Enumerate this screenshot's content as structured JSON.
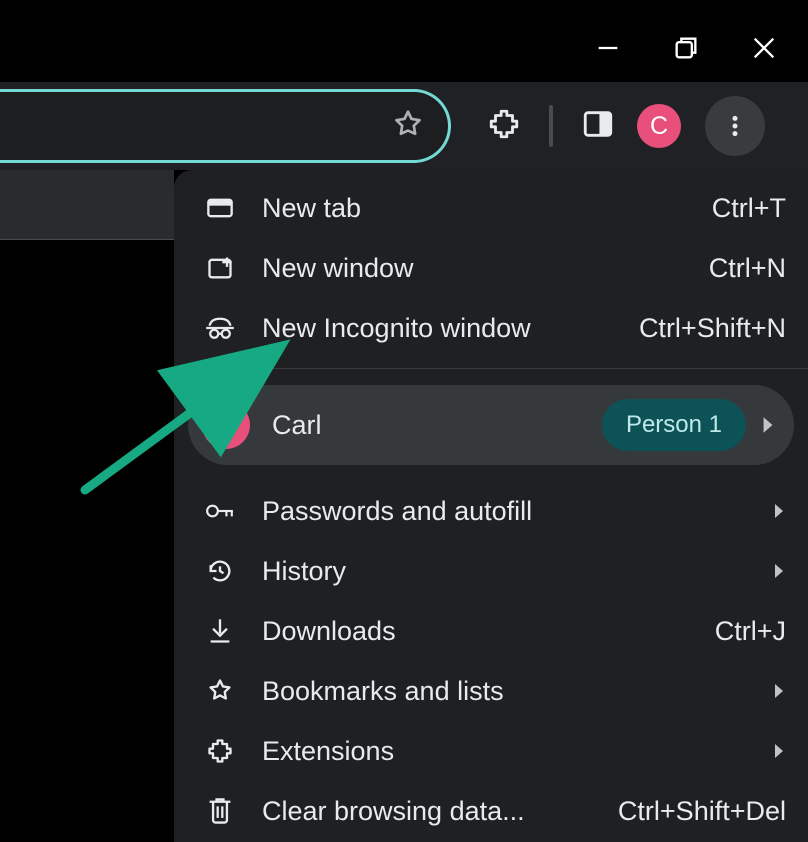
{
  "window_controls": {
    "minimize": "minimize",
    "maximize": "maximize",
    "close": "close"
  },
  "toolbar": {
    "omnibox_value": "",
    "star_icon": "bookmark-star",
    "extensions_icon": "extensions",
    "side_panel_icon": "side-panel",
    "profile_initial": "C",
    "overflow_icon": "more-vertical"
  },
  "profile": {
    "initial": "C",
    "name": "Carl",
    "person_badge": "Person 1"
  },
  "menu": {
    "new_tab": {
      "label": "New tab",
      "shortcut": "Ctrl+T"
    },
    "new_window": {
      "label": "New window",
      "shortcut": "Ctrl+N"
    },
    "incognito": {
      "label": "New Incognito window",
      "shortcut": "Ctrl+Shift+N"
    },
    "passwords": {
      "label": "Passwords and autofill"
    },
    "history": {
      "label": "History"
    },
    "downloads": {
      "label": "Downloads",
      "shortcut": "Ctrl+J"
    },
    "bookmarks": {
      "label": "Bookmarks and lists"
    },
    "extensions": {
      "label": "Extensions"
    },
    "clear_data": {
      "label": "Clear browsing data...",
      "shortcut": "Ctrl+Shift+Del"
    }
  },
  "colors": {
    "accent_teal": "#74d8d4",
    "avatar_pink": "#e84f7a",
    "badge_bg": "#0d5257",
    "arrow": "#17a983"
  }
}
